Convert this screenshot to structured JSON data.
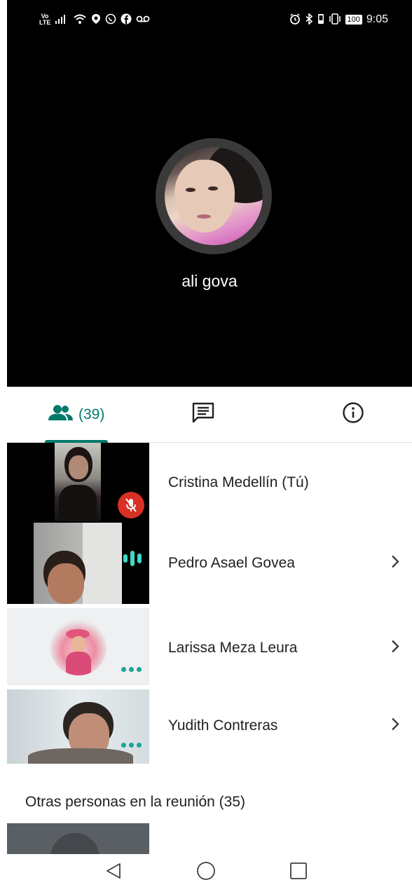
{
  "status_bar": {
    "network_label": "Vo LTE",
    "battery_level": "100",
    "time": "9:05",
    "left_icons": [
      "volte-icon",
      "signal-icon",
      "wifi-icon",
      "location-icon",
      "whatsapp-icon",
      "facebook-icon",
      "voicemail-icon"
    ],
    "right_icons": [
      "alarm-icon",
      "bluetooth-icon",
      "vibrate-icon",
      "battery-icon"
    ]
  },
  "call": {
    "caller_name": "ali gova"
  },
  "tabs": {
    "people_count": "(39)",
    "active_tab": "people",
    "accent_color": "#00796b"
  },
  "participants": [
    {
      "name": "Cristina Medellín (Tú)",
      "status": "muted",
      "has_chevron": false
    },
    {
      "name": "Pedro Asael Govea",
      "status": "speaking",
      "has_chevron": true
    },
    {
      "name": "Larissa Meza Leura",
      "status": "more",
      "has_chevron": true
    },
    {
      "name": "Yudith Contreras",
      "status": "more",
      "has_chevron": true
    }
  ],
  "other_section": {
    "title": "Otras personas en la reunión (35)"
  },
  "colors": {
    "mute_red": "#d93025",
    "teal": "#1aa59a",
    "speaking_teal": "#3ddbc7"
  }
}
